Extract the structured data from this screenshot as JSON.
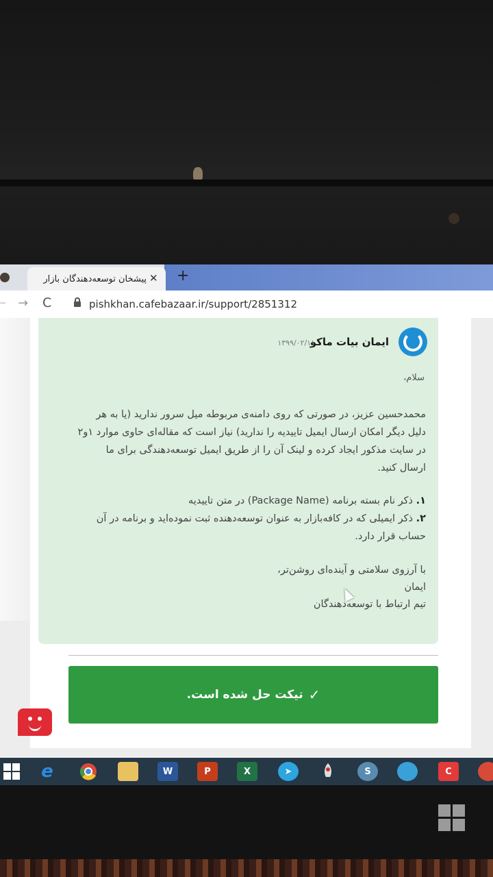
{
  "browser": {
    "tab_title": "پیشخان توسعه‌دهندگان بازار",
    "tab_close": "✕",
    "new_tab": "+",
    "url": "pishkhan.cafebazaar.ir/support/2851312",
    "nav": {
      "back": "←",
      "forward": "→",
      "reload": "C"
    }
  },
  "message": {
    "author": "ایمان بیات ماکو",
    "date": "۱۳۹۹/۰۲/۱۱",
    "greeting": "سلام،",
    "paragraph": "محمدحسین عزیز، در صورتی که روی دامنه‌ی مربوطه میل سرور ندارید (یا به هر دلیل دیگر امکان ارسال ایمیل تاییدیه را ندارید) نیاز است که مقاله‌ای حاوی موارد ۱و۲ در سایت مذکور ایجاد کرده و لینک آن را از طریق ایمیل توسعه‌دهندگی برای ما ارسال کنید.",
    "list": [
      {
        "num": "۱.",
        "text": "ذکر نام بسته برنامه (Package Name) در متن تاییدیه"
      },
      {
        "num": "۲.",
        "text": "ذکر ایمیلی که در کافه‌بازار به عنوان توسعه‌دهنده ثبت نموده‌اید و برنامه در آن حساب قرار دارد."
      }
    ],
    "closing_1": "با آرزوی سلامتی و آینده‌ای روشن‌تر،",
    "closing_2": "ایمان",
    "closing_3": "تیم ارتباط با توسعه‌دهندگان"
  },
  "status": {
    "resolved_label": "تیکت حل شده است.",
    "check": "✓"
  },
  "taskbar": {
    "items": [
      "windows-start",
      "internet-explorer",
      "chrome",
      "file-explorer",
      "word",
      "powerpoint",
      "excel",
      "telegram",
      "rocket-app",
      "store-app",
      "browser-app",
      "red-app",
      "chrome-2"
    ],
    "word_label": "W",
    "ppt_label": "P",
    "excel_label": "X"
  },
  "colors": {
    "resolved_green": "#2f9a3f",
    "message_bg": "#ddefdf",
    "avatar_blue": "#1f8fd4",
    "chat_red": "#e02a34",
    "taskbar": "#263746"
  }
}
